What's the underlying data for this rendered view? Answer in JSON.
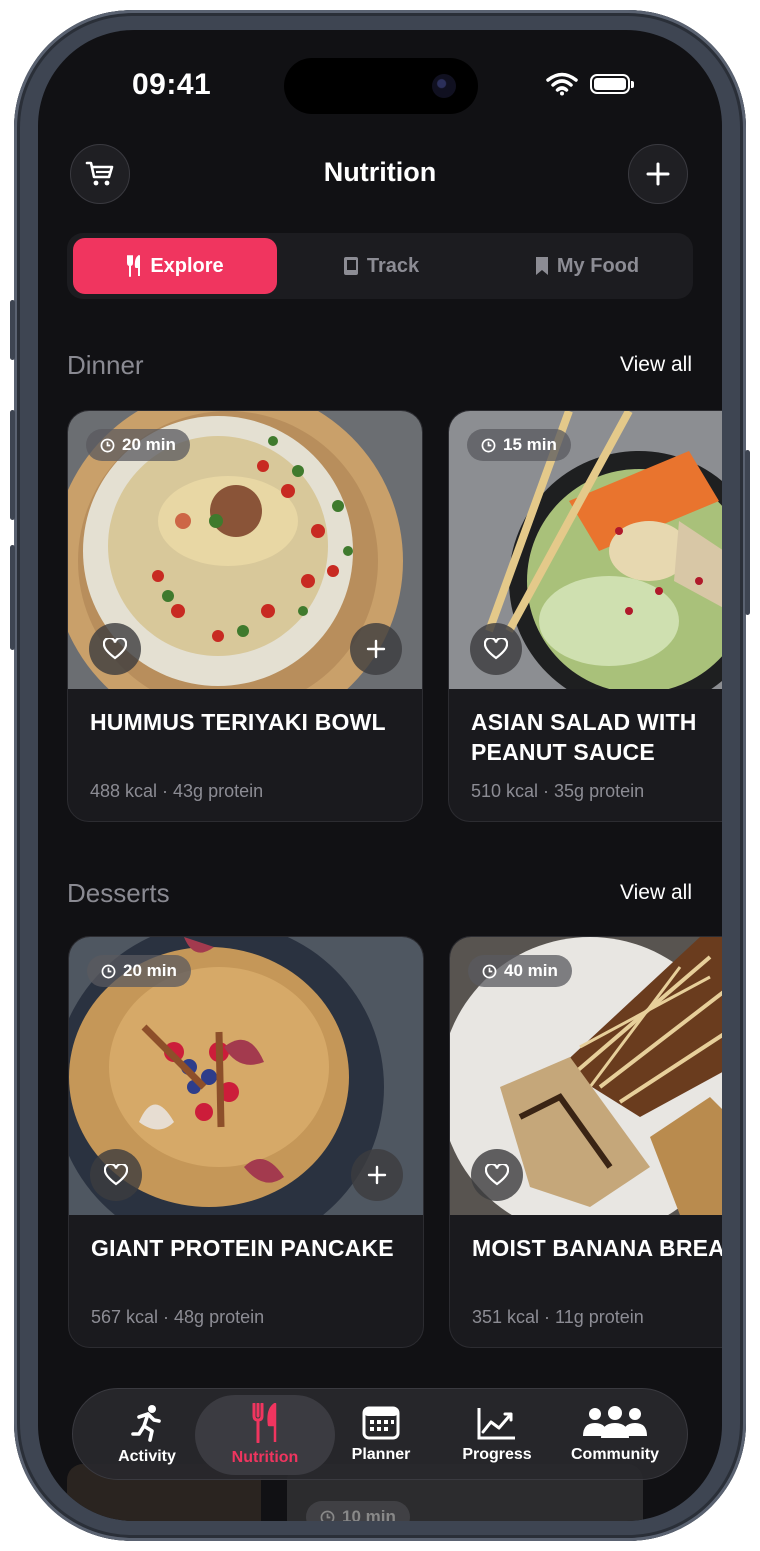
{
  "status_bar": {
    "time": "09:41"
  },
  "header": {
    "title": "Nutrition",
    "left_icon": "cart-icon",
    "right_icon": "plus-icon"
  },
  "segments": [
    {
      "label": "Explore",
      "icon": "fork-knife-icon",
      "active": true
    },
    {
      "label": "Track",
      "icon": "book-icon",
      "active": false
    },
    {
      "label": "My Food",
      "icon": "bookmark-icon",
      "active": false
    }
  ],
  "sections": [
    {
      "title": "Dinner",
      "view_all": "View all",
      "cards": [
        {
          "time": "20 min",
          "name": "HUMMUS TERIYAKI BOWL",
          "meta": "488 kcal · 43g protein"
        },
        {
          "time": "15 min",
          "name": "ASIAN SALAD WITH PEANUT SAUCE",
          "meta": "510 kcal · 35g protein"
        }
      ]
    },
    {
      "title": "Desserts",
      "view_all": "View all",
      "cards": [
        {
          "time": "20 min",
          "name": "GIANT PROTEIN PANCAKE",
          "meta": "567 kcal · 48g protein"
        },
        {
          "time": "40 min",
          "name": "MOIST BANANA BREAD",
          "meta": "351 kcal · 11g protein"
        }
      ]
    }
  ],
  "peek_card": {
    "time": "10 min"
  },
  "tabbar": [
    {
      "label": "Activity",
      "icon": "running-icon",
      "active": false
    },
    {
      "label": "Nutrition",
      "icon": "fork-knife-icon",
      "active": true
    },
    {
      "label": "Planner",
      "icon": "calendar-icon",
      "active": false
    },
    {
      "label": "Progress",
      "icon": "chart-icon",
      "active": false
    },
    {
      "label": "Community",
      "icon": "people-icon",
      "active": false
    }
  ],
  "colors": {
    "accent": "#f0355f",
    "background": "#111114",
    "card": "#1a1a1e"
  }
}
